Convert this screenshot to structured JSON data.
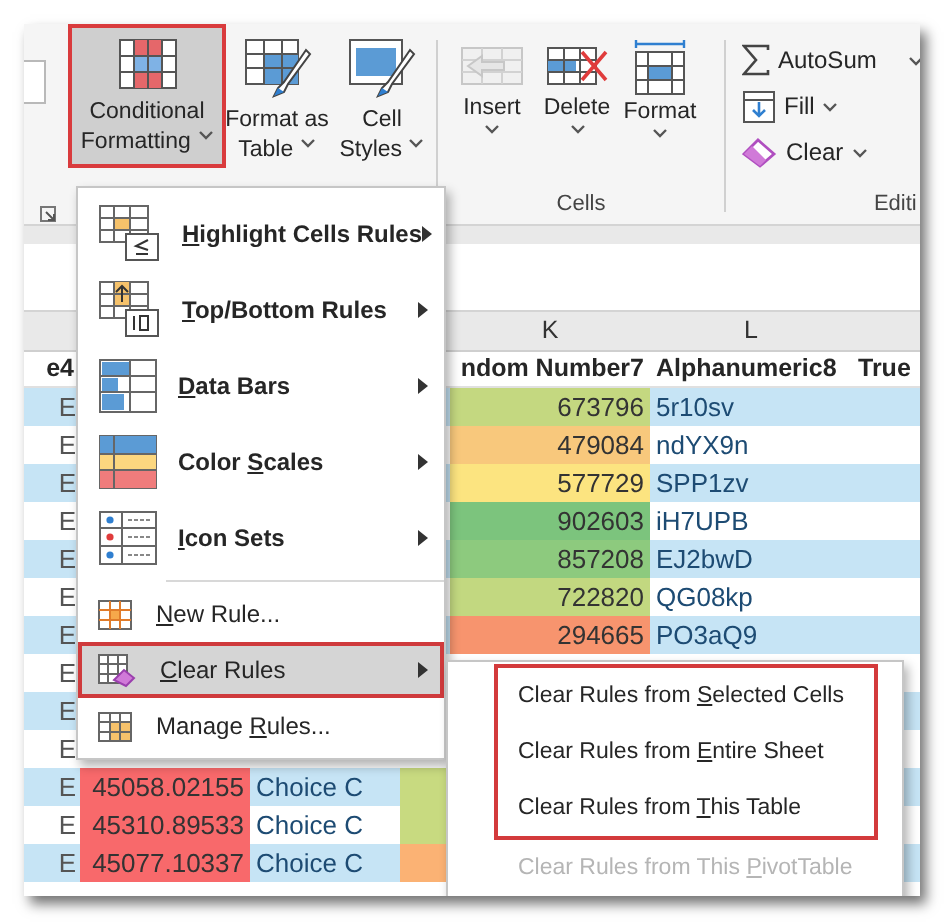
{
  "ribbon": {
    "styles_group": {
      "buttons": [
        {
          "kind": "conditional",
          "lines": [
            "Conditional",
            "Formatting"
          ],
          "selected": true,
          "outlined": true
        },
        {
          "kind": "table",
          "lines": [
            "Format as",
            "Table"
          ],
          "selected": false,
          "outlined": false
        },
        {
          "kind": "styles",
          "lines": [
            "Cell",
            "Styles"
          ],
          "selected": false,
          "outlined": false
        }
      ]
    },
    "cells_group": {
      "label": "Cells",
      "buttons": [
        {
          "kind": "insert",
          "label": "Insert",
          "disabled": true
        },
        {
          "kind": "delete",
          "label": "Delete",
          "disabled": false
        },
        {
          "kind": "format",
          "label": "Format",
          "disabled": false
        }
      ]
    },
    "editing_group": {
      "label": "Editi",
      "buttons": [
        {
          "kind": "autosum",
          "label": "AutoSum"
        },
        {
          "kind": "fill",
          "label": "Fill"
        },
        {
          "kind": "clear",
          "label": "Clear"
        }
      ]
    }
  },
  "sheet": {
    "column_letters": {
      "column_k": "K",
      "column_l": "L"
    },
    "headers": {
      "column_e": "e4",
      "column_k": "ndom Number7",
      "column_l": "Alphanumeric8",
      "column_true": "True"
    },
    "rows": [
      {
        "column_e": "E",
        "column_k": {
          "text": "673796",
          "color": "#c4d880"
        },
        "column_l": "5r10sv"
      },
      {
        "column_e": "E",
        "column_k": {
          "text": "479084",
          "color": "#f8c87c"
        },
        "column_l": "ndYX9n"
      },
      {
        "column_e": "E",
        "column_k": {
          "text": "577729",
          "color": "#fce480"
        },
        "column_l": "SPP1zv"
      },
      {
        "column_e": "E",
        "column_k": {
          "text": "902603",
          "color": "#7cc47d"
        },
        "column_l": "iH7UPB"
      },
      {
        "column_e": "E",
        "column_k": {
          "text": "857208",
          "color": "#8dca7e"
        },
        "column_l": "EJ2bwD"
      },
      {
        "column_e": "E",
        "column_k": {
          "text": "722820",
          "color": "#c2d880"
        },
        "column_l": "QG08kp"
      },
      {
        "column_e": "E",
        "column_k": {
          "text": "294665",
          "color": "#f7946e"
        },
        "column_l": "PO3aQ9"
      },
      {
        "column_e": "E"
      },
      {
        "column_e": "E"
      },
      {
        "column_e": "E"
      },
      {
        "column_e": "E",
        "column_1": {
          "text": "45058.02155",
          "color": "#f8696b"
        },
        "column_2": "Choice C",
        "column_3": {
          "color": "#c8da80"
        }
      },
      {
        "column_e": "E",
        "column_1": {
          "text": "45310.89533",
          "color": "#f8696b"
        },
        "column_2": "Choice C",
        "column_3": {
          "color": "#c8da80"
        }
      },
      {
        "column_e": "E",
        "column_1": {
          "text": "45077.10337",
          "color": "#f8696b"
        },
        "column_2": "Choice C",
        "column_3": {
          "color": "#fbb274"
        }
      }
    ]
  },
  "menu": {
    "items": [
      {
        "kind": "highlight",
        "key": "H",
        "post": "ighlight Cells Rules",
        "submenu": true,
        "selected": false,
        "outlined": false
      },
      {
        "kind": "topbottom",
        "key": "T",
        "post": "op/Bottom Rules",
        "submenu": true,
        "selected": false,
        "outlined": false
      },
      {
        "kind": "databars",
        "key": "D",
        "post": "ata Bars",
        "submenu": true,
        "selected": false,
        "outlined": false
      },
      {
        "kind": "colorscales",
        "pre": "Color ",
        "key": "S",
        "post": "cales",
        "submenu": true,
        "selected": false,
        "outlined": false
      },
      {
        "kind": "iconsets",
        "key": "I",
        "post": "con Sets",
        "submenu": true,
        "selected": false,
        "outlined": false
      },
      {
        "kind": "newrule",
        "key": "N",
        "post": "ew Rule...",
        "submenu": false,
        "selected": false,
        "outlined": false
      },
      {
        "kind": "clearrules",
        "key": "C",
        "post": "lear Rules",
        "submenu": true,
        "selected": true,
        "outlined": true
      },
      {
        "kind": "managerules",
        "pre": "Manage ",
        "key": "R",
        "post": "ules...",
        "submenu": false,
        "selected": false,
        "outlined": false
      }
    ]
  },
  "submenu": {
    "items": [
      {
        "pre": "Clear Rules from ",
        "key": "S",
        "post": "elected Cells",
        "disabled": false,
        "outlined": true
      },
      {
        "pre": "Clear Rules from ",
        "key": "E",
        "post": "ntire Sheet",
        "disabled": false,
        "outlined": true
      },
      {
        "pre": "Clear Rules from ",
        "key": "T",
        "post": "his Table",
        "disabled": false,
        "outlined": true
      },
      {
        "pre": "Clear Rules from This ",
        "key": "P",
        "post": "ivotTable",
        "disabled": true,
        "outlined": false
      }
    ]
  }
}
